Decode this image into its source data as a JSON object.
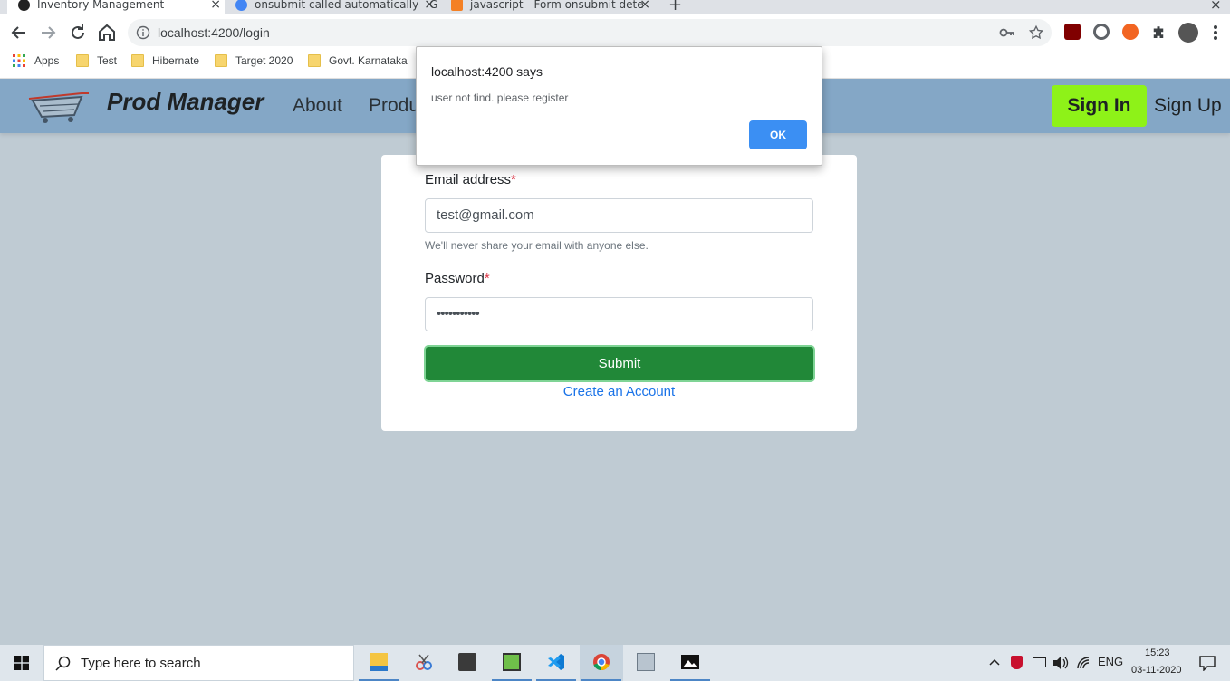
{
  "browser": {
    "tabs": [
      {
        "title": "Inventory Management",
        "active": true
      },
      {
        "title": "onsubmit called automatically - G",
        "active": false
      },
      {
        "title": "javascript - Form onsubmit dete",
        "active": false
      }
    ],
    "new_tab_glyph": "+",
    "close_glyph": "×",
    "url": "localhost:4200/login",
    "bookmarks": [
      {
        "label": "Apps",
        "icon": "apps-grid-icon"
      },
      {
        "label": "Test",
        "icon": "folder-icon"
      },
      {
        "label": "Hibernate",
        "icon": "folder-icon"
      },
      {
        "label": "Target 2020",
        "icon": "folder-icon"
      },
      {
        "label": "Govt. Karnataka",
        "icon": "folder-icon"
      }
    ]
  },
  "navbar": {
    "brand": "Prod Manager",
    "links": [
      "About",
      "Produ"
    ],
    "signin": "Sign In",
    "signup": "Sign Up",
    "background": "#84a7c6",
    "signin_color": "#8ef218"
  },
  "form": {
    "email_label": "Email address",
    "required_mark": "*",
    "email_value": "test@gmail.com",
    "email_help": "We'll never share your email with anyone else.",
    "password_label": "Password",
    "password_value": "•••••••••••",
    "submit_label": "Submit",
    "create_account": "Create an Account",
    "submit_color": "#218838"
  },
  "alert": {
    "title": "localhost:4200 says",
    "message": "user not find. please register",
    "ok": "OK"
  },
  "taskbar": {
    "search_placeholder": "Type here to search",
    "language": "ENG",
    "time": "15:23",
    "date": "03-11-2020"
  }
}
